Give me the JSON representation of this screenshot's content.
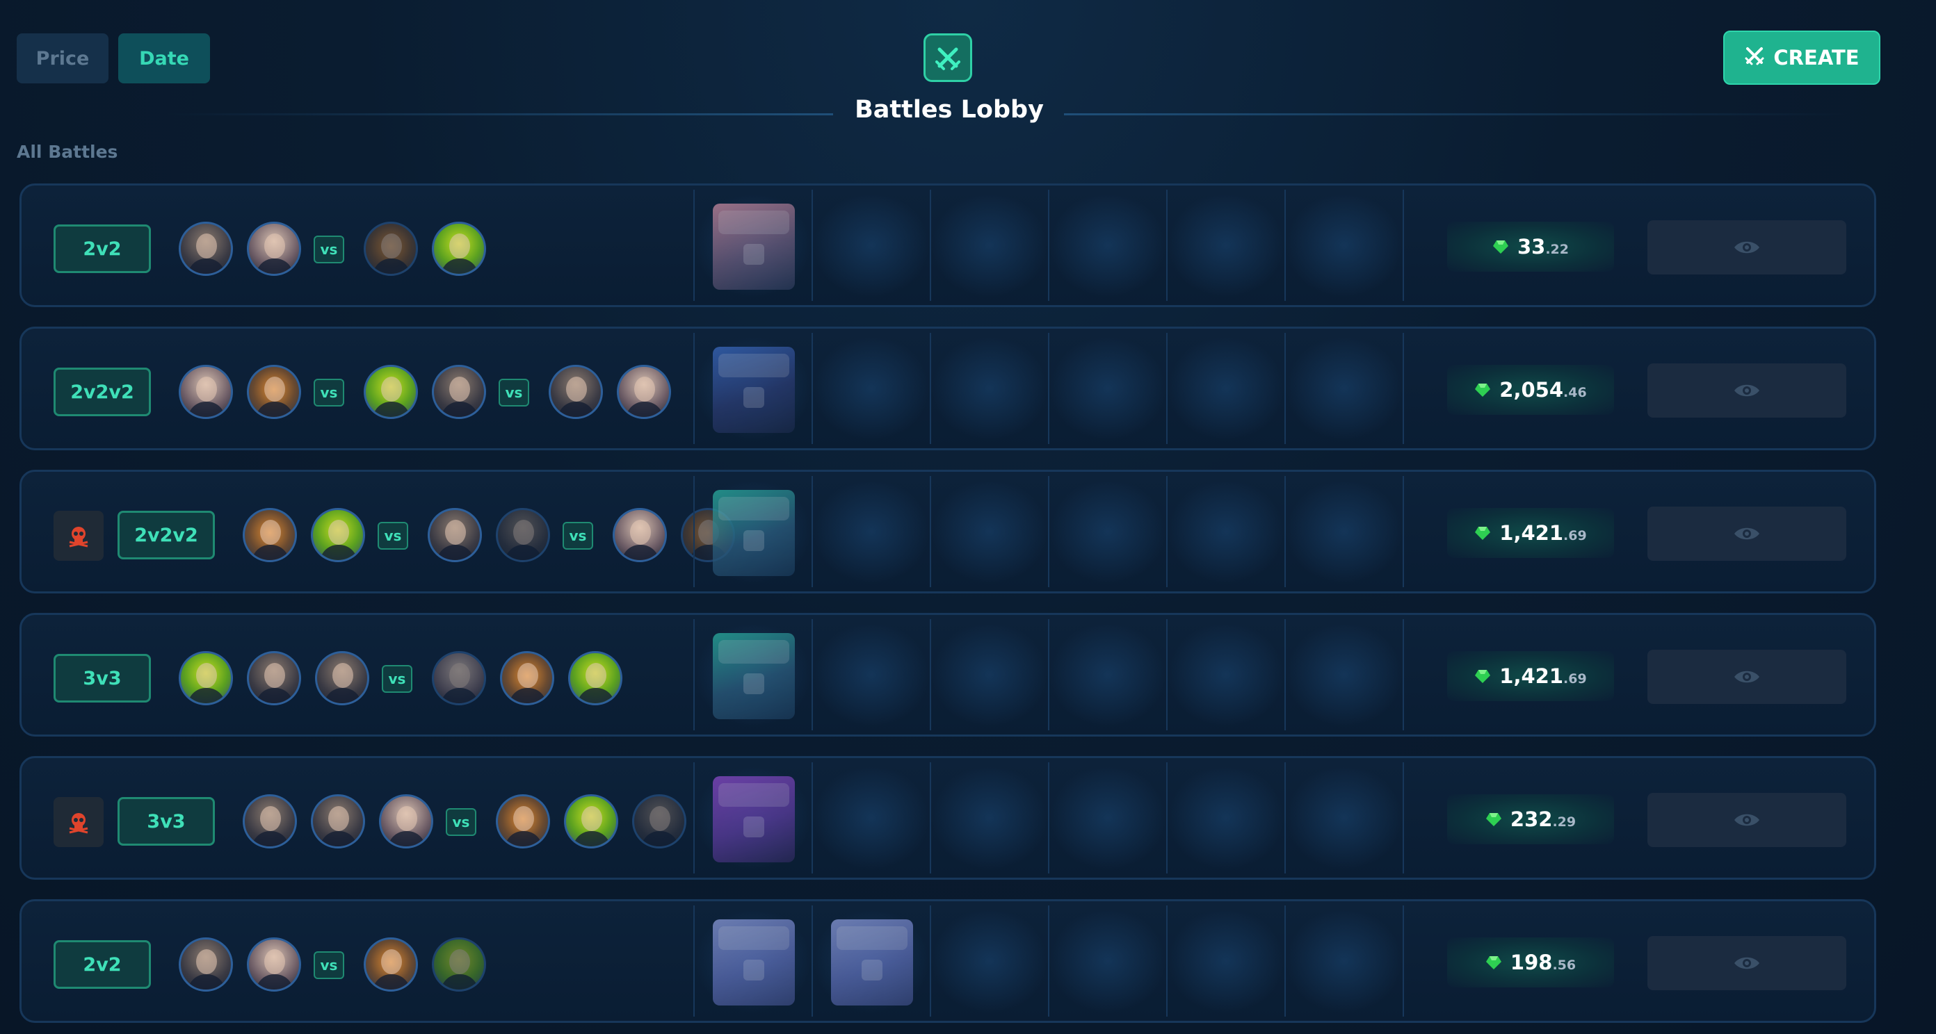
{
  "sort": {
    "price_label": "Price",
    "date_label": "Date",
    "active": "Date"
  },
  "header": {
    "title": "Battles Lobby",
    "create_label": "CREATE"
  },
  "section_label": "All Battles",
  "colors": {
    "accent": "#1fb38f",
    "accent_text": "#3fe0b8",
    "background": "#0a1c30",
    "muted": "#5d7891"
  },
  "icons": {
    "logo": "crossed-swords-icon",
    "create": "crossed-swords-icon",
    "skull": "skull-icon",
    "gem": "gem-icon",
    "view": "eye-icon"
  },
  "vs_label": "vs",
  "battles": [
    {
      "mode": "2v2",
      "crazy": false,
      "teams": [
        2,
        2
      ],
      "cases": 1,
      "price_main": "33",
      "price_cents": ".22"
    },
    {
      "mode": "2v2v2",
      "crazy": false,
      "teams": [
        2,
        2,
        2
      ],
      "cases": 1,
      "price_main": "2,054",
      "price_cents": ".46"
    },
    {
      "mode": "2v2v2",
      "crazy": true,
      "teams": [
        2,
        2,
        2
      ],
      "cases": 1,
      "price_main": "1,421",
      "price_cents": ".69"
    },
    {
      "mode": "3v3",
      "crazy": false,
      "teams": [
        3,
        3
      ],
      "cases": 1,
      "price_main": "1,421",
      "price_cents": ".69"
    },
    {
      "mode": "3v3",
      "crazy": true,
      "teams": [
        3,
        3
      ],
      "cases": 1,
      "price_main": "232",
      "price_cents": ".29"
    },
    {
      "mode": "2v2",
      "crazy": false,
      "teams": [
        2,
        2
      ],
      "cases": 2,
      "price_main": "198",
      "price_cents": ".56"
    }
  ]
}
